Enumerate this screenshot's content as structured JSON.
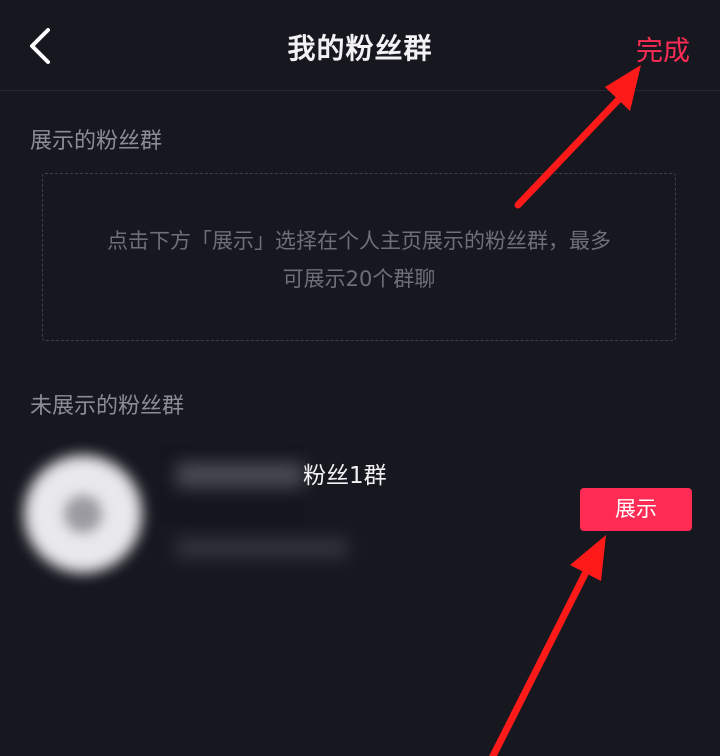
{
  "header": {
    "title": "我的粉丝群",
    "done_label": "完成"
  },
  "shown_section": {
    "label": "展示的粉丝群",
    "hint_line1": "点击下方「展示」选择在个人主页展示的粉丝群，最多",
    "hint_line2": "可展示20个群聊"
  },
  "hidden_section": {
    "label": "未展示的粉丝群",
    "groups": [
      {
        "name": "粉丝1群",
        "button_label": "展示"
      }
    ]
  },
  "colors": {
    "background": "#16171f",
    "accent": "#fe2c55",
    "annotation_arrow": "#ff1a1a"
  }
}
